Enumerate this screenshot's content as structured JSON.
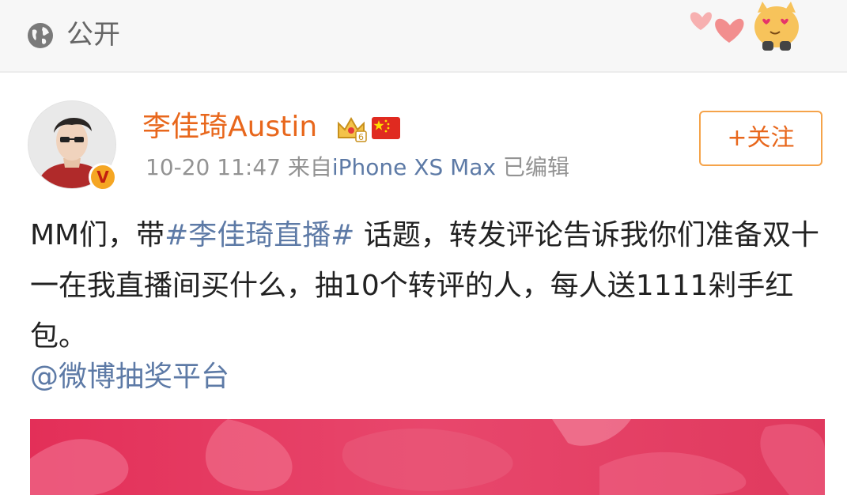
{
  "header": {
    "privacy_label": "公开",
    "globe_icon": "globe-icon",
    "sticker": "heart-cat-sticker"
  },
  "post": {
    "username": "李佳琦Austin",
    "member_badge": "crown-icon",
    "flag_badge": "china-flag-icon",
    "verified_badge": "V",
    "timestamp": "10-20 11:47",
    "source_prefix": "来自",
    "source_device": "iPhone XS Max",
    "edited_label": "已编辑",
    "follow_button": "+关注",
    "text_part1": "MM们，带",
    "hashtag": "#李佳琦直播#",
    "text_part2": " 话题，转发评论告诉我你们准备双十一在我直播间买什么，抽10个转评的人，每人送1111剁手红包。",
    "mention": "@微博抽奖平台"
  },
  "colors": {
    "accent_orange": "#e8671c",
    "link_blue": "#5d7aa6",
    "image_red": "#e3365a"
  }
}
